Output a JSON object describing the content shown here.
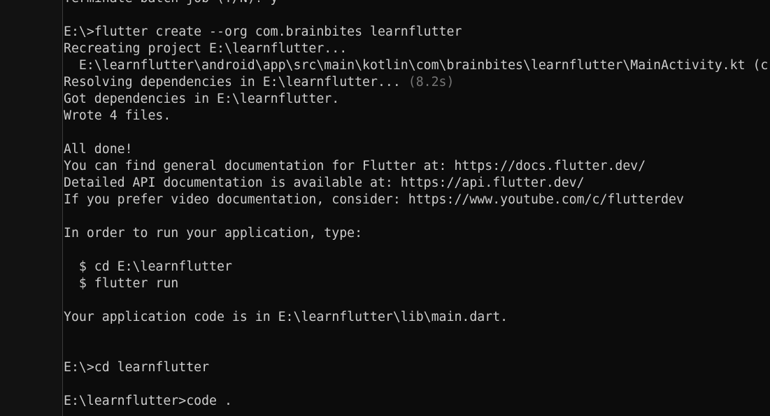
{
  "colors": {
    "background": "#0c0c0c",
    "text": "#cccccc",
    "dim_text": "#767676"
  },
  "terminal": {
    "lines": [
      {
        "text": "Terminate batch job (Y/N)? y"
      },
      {
        "text": ""
      },
      {
        "text": "E:\\>flutter create --org com.brainbites learnflutter"
      },
      {
        "text": "Recreating project E:\\learnflutter..."
      },
      {
        "text": "  E:\\learnflutter\\android\\app\\src\\main\\kotlin\\com\\brainbites\\learnflutter\\MainActivity.kt (c"
      },
      {
        "text": "Resolving dependencies in E:\\learnflutter... ",
        "dim": "(8.2s)"
      },
      {
        "text": "Got dependencies in E:\\learnflutter."
      },
      {
        "text": "Wrote 4 files."
      },
      {
        "text": ""
      },
      {
        "text": "All done!"
      },
      {
        "text": "You can find general documentation for Flutter at: https://docs.flutter.dev/"
      },
      {
        "text": "Detailed API documentation is available at: https://api.flutter.dev/"
      },
      {
        "text": "If you prefer video documentation, consider: https://www.youtube.com/c/flutterdev"
      },
      {
        "text": ""
      },
      {
        "text": "In order to run your application, type:"
      },
      {
        "text": ""
      },
      {
        "text": "  $ cd E:\\learnflutter"
      },
      {
        "text": "  $ flutter run"
      },
      {
        "text": ""
      },
      {
        "text": "Your application code is in E:\\learnflutter\\lib\\main.dart."
      },
      {
        "text": ""
      },
      {
        "text": ""
      },
      {
        "text": "E:\\>cd learnflutter"
      },
      {
        "text": ""
      },
      {
        "text": "E:\\learnflutter>code ."
      }
    ]
  }
}
